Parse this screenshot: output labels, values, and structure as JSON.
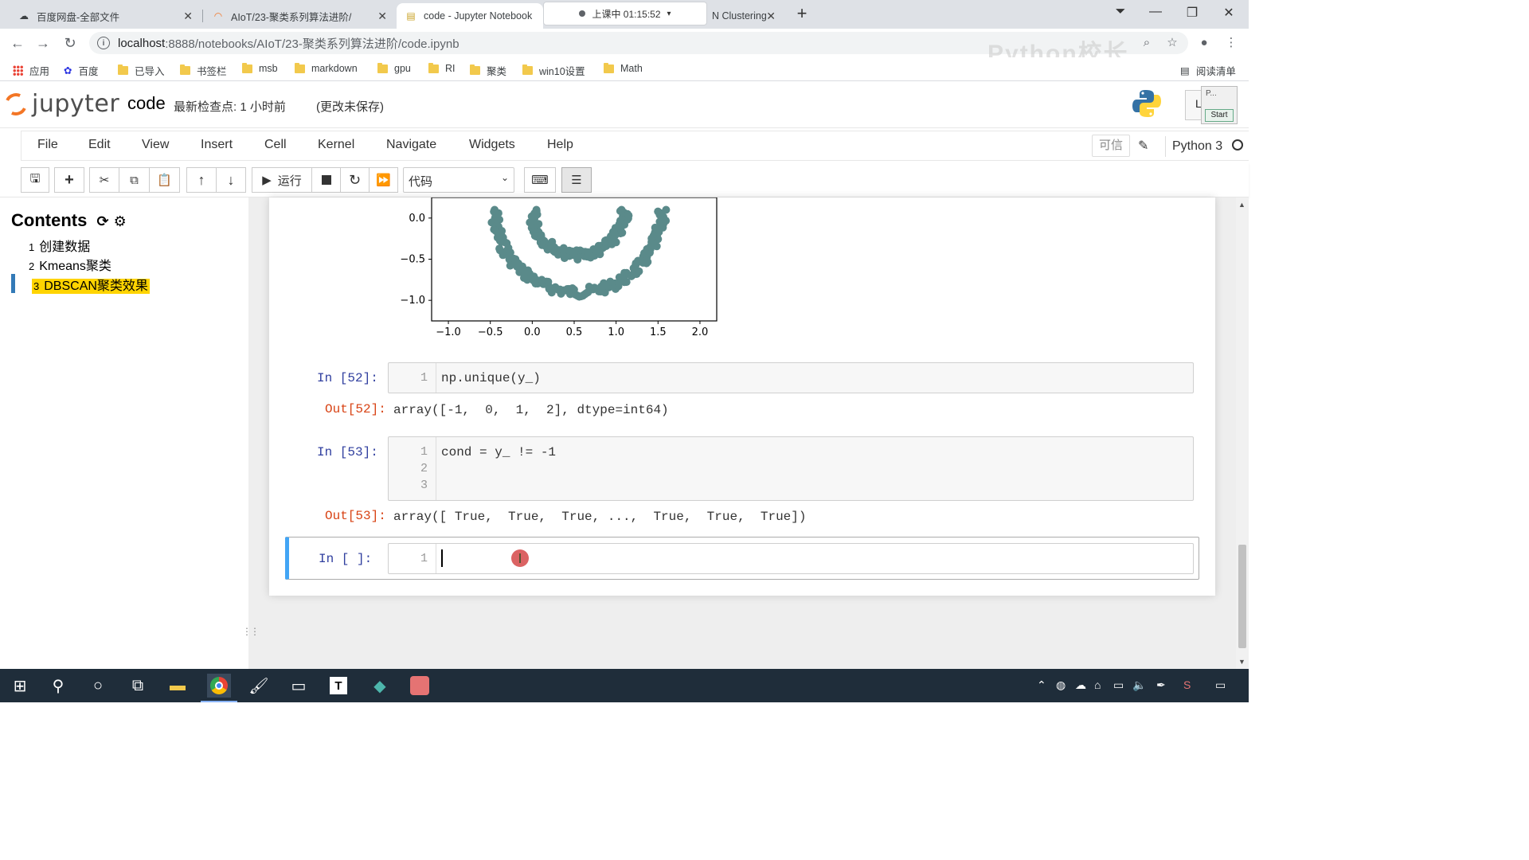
{
  "browser": {
    "tabs": [
      {
        "title": "百度网盘-全部文件",
        "icon": "baidu-netdisk-icon"
      },
      {
        "title": "AIoT/23-聚类系列算法进阶/",
        "icon": "jupyter-icon"
      },
      {
        "title": "code - Jupyter Notebook",
        "icon": "notebook-icon"
      },
      {
        "title": "N Clustering",
        "icon": "tab-icon"
      }
    ],
    "recording_label": "上课中 01:15:52",
    "url_host": "localhost",
    "url_path": ":8888/notebooks/AIoT/23-聚类系列算法进阶/code.ipynb",
    "watermark": "Python校长",
    "bookmarks": [
      "应用",
      "百度",
      "已导入",
      "书签栏",
      "msb",
      "markdown",
      "gpu",
      "RI",
      "聚类",
      "win10设置",
      "Math"
    ],
    "reading_list": "阅读清单"
  },
  "jupyter": {
    "logo_text": "jupyter",
    "notebook_name": "code",
    "checkpoint": "最新检查点: 1 小时前",
    "unsaved": "(更改未保存)",
    "logout_label": "L",
    "popup_title": "P...",
    "popup_button": "Start",
    "menu": [
      "File",
      "Edit",
      "View",
      "Insert",
      "Cell",
      "Kernel",
      "Navigate",
      "Widgets",
      "Help"
    ],
    "trusted": "可信",
    "kernel": "Python 3",
    "run_label": "运行",
    "cell_type": "代码"
  },
  "toc": {
    "title": "Contents",
    "items": [
      {
        "num": "1",
        "label": "创建数据"
      },
      {
        "num": "2",
        "label": "Kmeans聚类"
      },
      {
        "num": "3",
        "label": "DBSCAN聚类效果"
      }
    ]
  },
  "plot": {
    "yticks": [
      "0.0",
      "−0.5",
      "−1.0"
    ],
    "xticks": [
      "−1.0",
      "−0.5",
      "0.0",
      "0.5",
      "1.0",
      "1.5",
      "2.0"
    ]
  },
  "chart_data": {
    "type": "scatter",
    "title": "",
    "xlim": [
      -1.2,
      2.2
    ],
    "ylim": [
      -1.25,
      0.25
    ],
    "series": [
      {
        "shape": "outer-ring-partial",
        "color": "#5a8a8a"
      },
      {
        "shape": "inner-ring-partial",
        "color": "#5a8a8a"
      }
    ]
  },
  "cells": [
    {
      "in_prompt": "In  [52]:",
      "lines": [
        "1"
      ],
      "code": "np.unique(y_)",
      "out_prompt": "Out[52]:",
      "output": "array([-1,  0,  1,  2], dtype=int64)"
    },
    {
      "in_prompt": "In  [53]:",
      "lines": [
        "1",
        "2",
        "3"
      ],
      "code": "cond = y_ != -1",
      "out_prompt": "Out[53]:",
      "output": "array([ True,  True,  True, ...,  True,  True,  True])"
    },
    {
      "in_prompt": "In  [ ]:",
      "lines": [
        "1"
      ],
      "code": ""
    }
  ]
}
